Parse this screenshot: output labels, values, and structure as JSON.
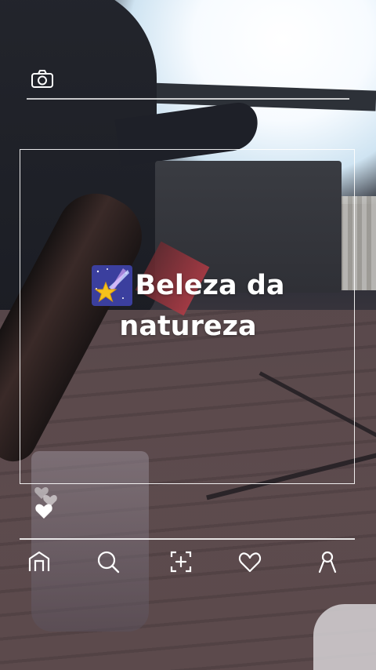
{
  "overlay": {
    "title_line1": "Beleza da",
    "title_line2": "natureza",
    "title_emoji": "shooting-star-emoji"
  },
  "top_bar": {
    "camera_icon": "camera-icon"
  },
  "reactions": {
    "icon": "hearts-icon"
  },
  "bottom_nav": {
    "items": [
      {
        "icon": "home-icon"
      },
      {
        "icon": "search-icon"
      },
      {
        "icon": "add-post-icon"
      },
      {
        "icon": "heart-icon"
      },
      {
        "icon": "profile-icon"
      }
    ]
  },
  "colors": {
    "overlay_stroke": "#ffffff",
    "emoji_bg": "#3b3f9e",
    "emoji_star": "#f6c21c"
  }
}
